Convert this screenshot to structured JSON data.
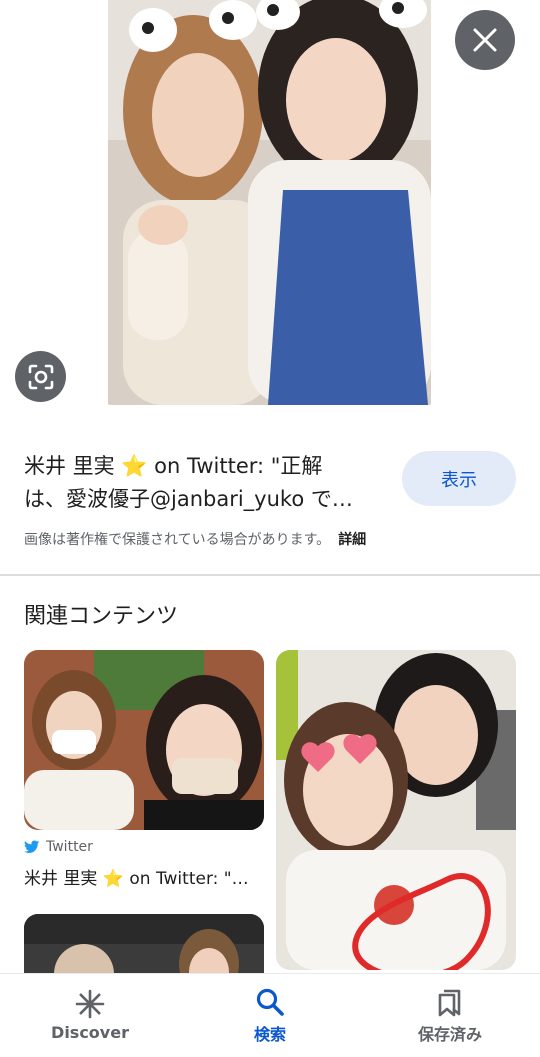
{
  "result": {
    "title_line1": "米井 里実 ⭐ on Twitter: \"正解",
    "title_line2": "は、愛波優子@janbari_yuko で…",
    "show_label": "表示",
    "copyright_notice": "画像は著作権で保護されている場合があります。",
    "details_label": "詳細"
  },
  "related": {
    "heading": "関連コンテンツ",
    "cards": [
      {
        "source": "Twitter",
        "title": "米井 里実 ⭐ on Twitter: \"…"
      }
    ]
  },
  "bottom_nav": {
    "items": [
      {
        "label": "Discover",
        "icon": "asterisk-icon",
        "active": false
      },
      {
        "label": "検索",
        "icon": "search-icon",
        "active": true
      },
      {
        "label": "保存済み",
        "icon": "bookmarks-icon",
        "active": false
      }
    ]
  },
  "colors": {
    "accent": "#0b57d0",
    "show_button_bg": "#e3ebf9",
    "overlay_button_bg": "#5f6368",
    "twitter_blue": "#1d9bf0"
  }
}
